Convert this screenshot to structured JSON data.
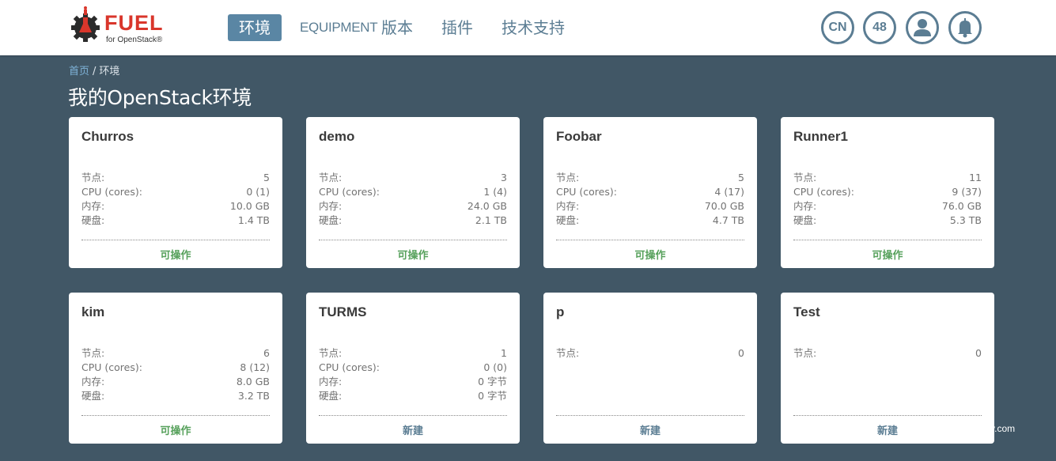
{
  "header": {
    "logo_title": "FUEL",
    "logo_subtitle": "for OpenStack®",
    "nav": [
      {
        "label": "环境"
      },
      {
        "label": "EQUIPMENT"
      },
      {
        "label": "版本"
      },
      {
        "label": "插件"
      },
      {
        "label": "技术支持"
      }
    ],
    "lang_label": "CN",
    "notif_count": "48"
  },
  "breadcrumb": {
    "home": "首页",
    "separator": "/",
    "current": "环境"
  },
  "page_title": "我的OpenStack环境",
  "environments": [
    {
      "name": "Churros",
      "status": "可操作",
      "status_type": "operational",
      "stats": [
        {
          "label": "节点:",
          "value": "5"
        },
        {
          "label": "CPU (cores):",
          "value": "0 (1)"
        },
        {
          "label": "内存:",
          "value": "10.0 GB"
        },
        {
          "label": "硬盘:",
          "value": "1.4 TB"
        }
      ]
    },
    {
      "name": "demo",
      "status": "可操作",
      "status_type": "operational",
      "stats": [
        {
          "label": "节点:",
          "value": "3"
        },
        {
          "label": "CPU (cores):",
          "value": "1 (4)"
        },
        {
          "label": "内存:",
          "value": "24.0 GB"
        },
        {
          "label": "硬盘:",
          "value": "2.1 TB"
        }
      ]
    },
    {
      "name": "Foobar",
      "status": "可操作",
      "status_type": "operational",
      "stats": [
        {
          "label": "节点:",
          "value": "5"
        },
        {
          "label": "CPU (cores):",
          "value": "4 (17)"
        },
        {
          "label": "内存:",
          "value": "70.0 GB"
        },
        {
          "label": "硬盘:",
          "value": "4.7 TB"
        }
      ]
    },
    {
      "name": "Runner1",
      "status": "可操作",
      "status_type": "operational",
      "stats": [
        {
          "label": "节点:",
          "value": "11"
        },
        {
          "label": "CPU (cores):",
          "value": "9 (37)"
        },
        {
          "label": "内存:",
          "value": "76.0 GB"
        },
        {
          "label": "硬盘:",
          "value": "5.3 TB"
        }
      ]
    },
    {
      "name": "kim",
      "status": "可操作",
      "status_type": "operational",
      "stats": [
        {
          "label": "节点:",
          "value": "6"
        },
        {
          "label": "CPU (cores):",
          "value": "8 (12)"
        },
        {
          "label": "内存:",
          "value": "8.0 GB"
        },
        {
          "label": "硬盘:",
          "value": "3.2 TB"
        }
      ]
    },
    {
      "name": "TURMS",
      "status": "新建",
      "status_type": "new",
      "stats": [
        {
          "label": "节点:",
          "value": "1"
        },
        {
          "label": "CPU (cores):",
          "value": "0 (0)"
        },
        {
          "label": "内存:",
          "value": "0 字节"
        },
        {
          "label": "硬盘:",
          "value": "0 字节"
        }
      ]
    },
    {
      "name": "p",
      "status": "新建",
      "status_type": "new",
      "stats": [
        {
          "label": "节点:",
          "value": "0"
        }
      ]
    },
    {
      "name": "Test",
      "status": "新建",
      "status_type": "new",
      "stats": [
        {
          "label": "节点:",
          "value": "0"
        }
      ]
    }
  ],
  "colors": {
    "background": "#415766",
    "nav_active": "#5a86a4",
    "nav_text": "#5b7d93",
    "status_operational": "#57a15c",
    "status_new": "#5b7d93",
    "logo_red": "#d9362b"
  },
  "icons": {
    "user": "user-icon",
    "bell": "bell-icon",
    "logo": "gear-flask-icon"
  },
  "watermark": "iyunv.com"
}
